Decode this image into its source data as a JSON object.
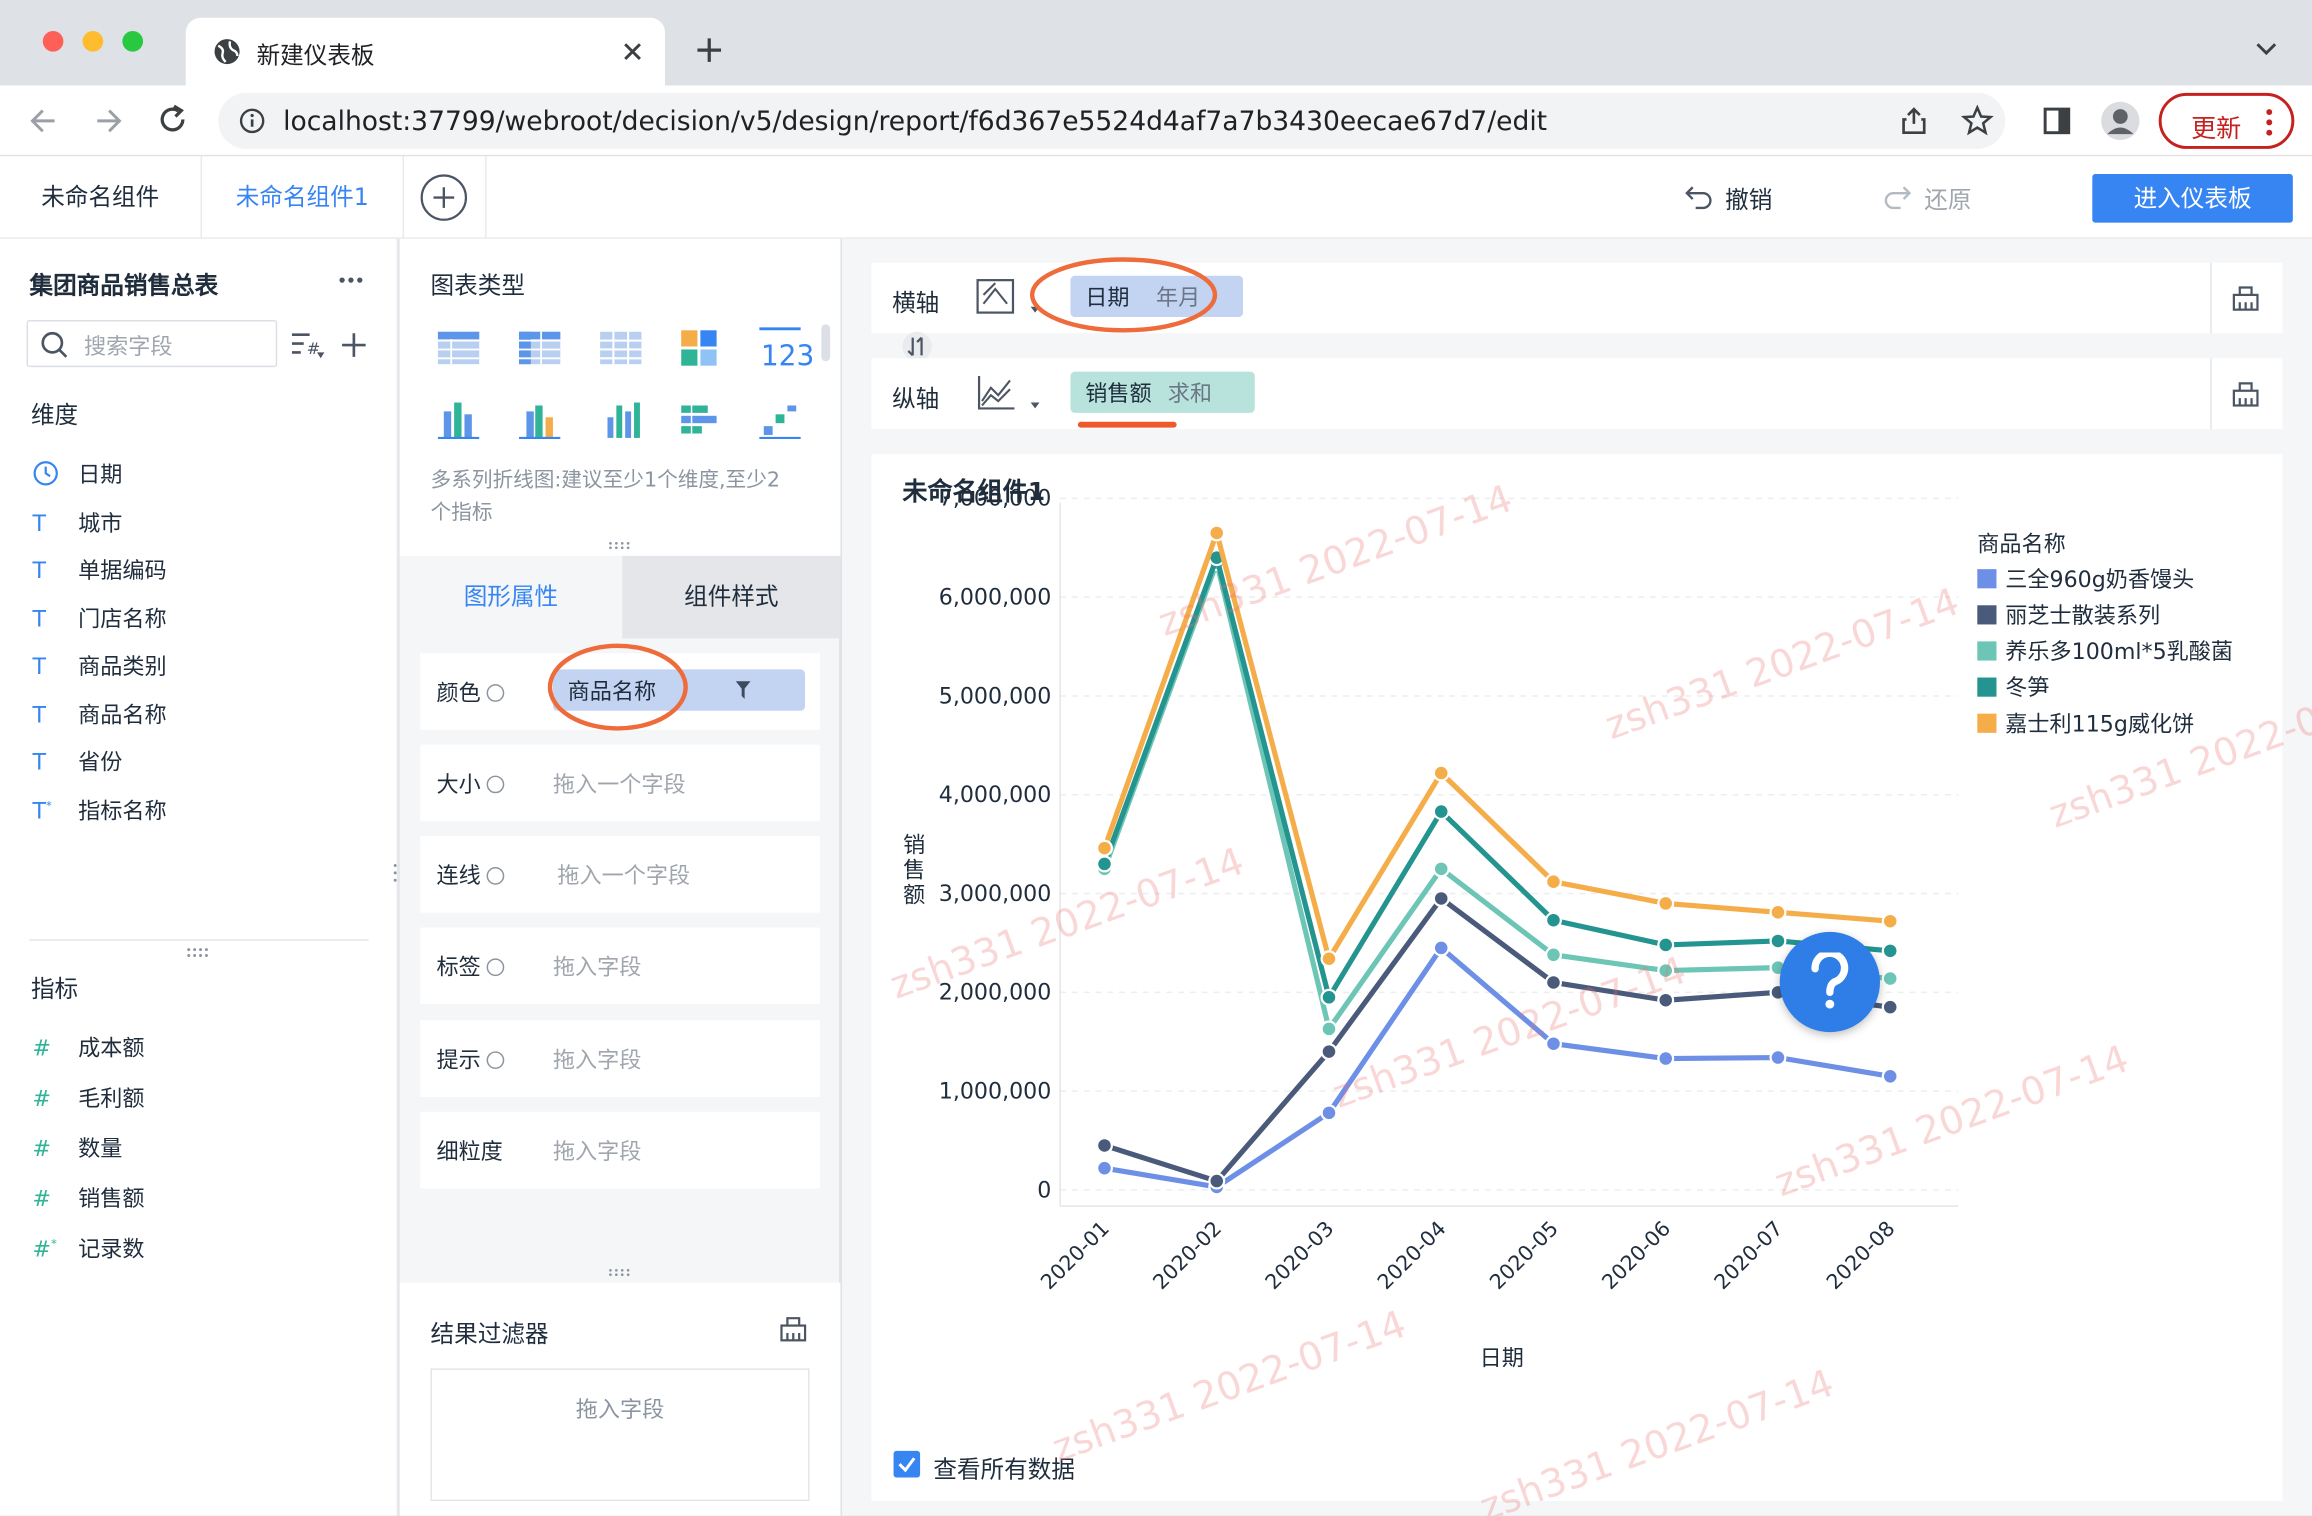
{
  "browser": {
    "tab_title": "新建仪表板",
    "url": "localhost:37799/webroot/decision/v5/design/report/f6d367e5524d4af7a7b3430eecae67d7/edit",
    "update_label": "更新"
  },
  "app": {
    "tabs": [
      "未命名组件",
      "未命名组件1"
    ],
    "undo_label": "撤销",
    "redo_label": "还原",
    "enter_label": "进入仪表板"
  },
  "datapanel": {
    "dataset_title": "集团商品销售总表",
    "search_placeholder": "搜索字段",
    "dim_title": "维度",
    "dimensions": [
      "日期",
      "城市",
      "单据编码",
      "门店名称",
      "商品类别",
      "商品名称",
      "省份",
      "指标名称"
    ],
    "measure_title": "指标",
    "measures": [
      "成本额",
      "毛利额",
      "数量",
      "销售额",
      "记录数"
    ]
  },
  "midpanel": {
    "chart_type_title": "图表类型",
    "chart_hint": "多系列折线图:建议至少1个维度,至少2个指标",
    "tab_graph": "图形属性",
    "tab_style": "组件样式",
    "props": [
      {
        "name": "颜色",
        "value": "商品名称"
      },
      {
        "name": "大小",
        "hint": "拖入一个字段"
      },
      {
        "name": "连线",
        "hint": "拖入一个字段"
      },
      {
        "name": "标签",
        "hint": "拖入字段"
      },
      {
        "name": "提示",
        "hint": "拖入字段"
      },
      {
        "name": "细粒度",
        "hint": "拖入字段"
      }
    ],
    "filter_title": "结果过滤器",
    "filter_hint": "拖入字段"
  },
  "axes": {
    "x_label": "横轴",
    "x_field": "日期",
    "x_sub": "年月",
    "y_label": "纵轴",
    "y_field": "销售额",
    "y_sub": "求和"
  },
  "widget": {
    "title": "未命名组件1",
    "view_all_label": "查看所有数据",
    "watermark": "zsh331 2022-07-14"
  },
  "chart_data": {
    "type": "line",
    "xlabel": "日期",
    "ylabel": "销售额",
    "legend_title": "商品名称",
    "categories": [
      "2020-01",
      "2020-02",
      "2020-03",
      "2020-04",
      "2020-05",
      "2020-06",
      "2020-07",
      "2020-08"
    ],
    "y_ticks": [
      "7,000,000",
      "6,000,000",
      "5,000,000",
      "4,000,000",
      "3,000,000",
      "2,000,000",
      "1,000,000",
      "0"
    ],
    "ylim": [
      0,
      7000000
    ],
    "legend_position": "top-right",
    "series": [
      {
        "name": "三全960g奶香馒头",
        "color": "#6d8fe6",
        "values": [
          220000,
          30000,
          780000,
          2450000,
          1480000,
          1330000,
          1340000,
          1150000
        ]
      },
      {
        "name": "丽芝士散装系列",
        "color": "#4a5a7a",
        "values": [
          450000,
          90000,
          1400000,
          2950000,
          2100000,
          1920000,
          2000000,
          1850000
        ]
      },
      {
        "name": "养乐多100ml*5乳酸菌",
        "color": "#6cc5b5",
        "values": [
          3250000,
          6350000,
          1630000,
          3250000,
          2380000,
          2220000,
          2250000,
          2140000
        ]
      },
      {
        "name": "冬笋",
        "color": "#23948f",
        "values": [
          3300000,
          6400000,
          1950000,
          3830000,
          2730000,
          2480000,
          2520000,
          2420000
        ]
      },
      {
        "name": "嘉士利115g威化饼",
        "color": "#f5ad4a",
        "values": [
          3460000,
          6650000,
          2340000,
          4220000,
          3120000,
          2900000,
          2810000,
          2720000
        ]
      }
    ]
  }
}
